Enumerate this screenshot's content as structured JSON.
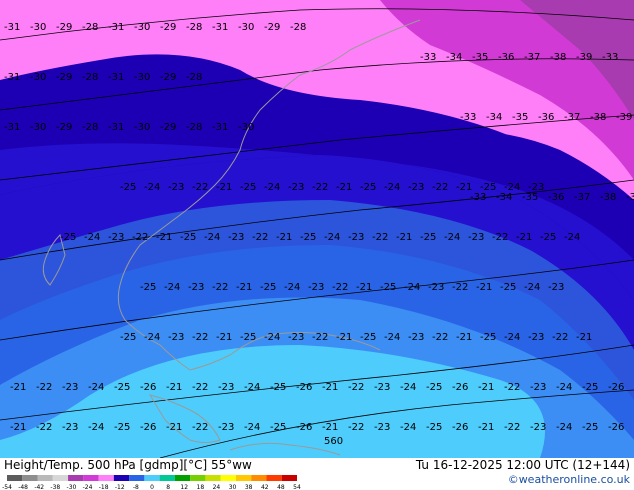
{
  "header": {
    "title": "Height/Temp. 500 hPa [gdmp][°C] 55°ww",
    "valid": "Tu 16-12-2025 12:00 UTC (12+144)",
    "credit": "©weatheronline.co.uk"
  },
  "map": {
    "contour_label": "560",
    "temperature_bands": [
      {
        "temp": -38,
        "color": "#a93bb0"
      },
      {
        "temp": -34,
        "color": "#d23ad6"
      },
      {
        "temp": -31,
        "color": "#ff7ff9"
      },
      {
        "temp": -29,
        "color": "#1e00b4"
      },
      {
        "temp": -27,
        "color": "#2510d0"
      },
      {
        "temp": -25,
        "color": "#2a64e6"
      },
      {
        "temp": -23,
        "color": "#3c8ef5"
      },
      {
        "temp": -22,
        "color": "#4aa8f8"
      },
      {
        "temp": -21,
        "color": "#4ecdfc"
      }
    ],
    "labels_top_left": [
      "-31",
      "-30",
      "-29",
      "-28"
    ],
    "labels_center": [
      "-25",
      "-24",
      "-23",
      "-22",
      "-21"
    ],
    "labels_right": [
      "-33",
      "-34",
      "-35",
      "-36",
      "-37",
      "-38",
      "-39"
    ],
    "labels_bottom": [
      "-21",
      "-22",
      "-23",
      "-24",
      "-25",
      "-26"
    ]
  },
  "legend": {
    "ticks": [
      "-54",
      "-48",
      "-42",
      "-38",
      "-30",
      "-24",
      "-18",
      "-12",
      "-8",
      "0",
      "8",
      "12",
      "18",
      "24",
      "30",
      "38",
      "42",
      "48",
      "54"
    ],
    "colors": [
      "#5c5c5c",
      "#8e8e8e",
      "#b9b9b9",
      "#d7d7d7",
      "#a93bb0",
      "#d23ad6",
      "#ff7ff9",
      "#1e00b4",
      "#2a64e6",
      "#4ecdfc",
      "#00c896",
      "#00a000",
      "#76d000",
      "#c8e000",
      "#ffff00",
      "#ffc800",
      "#ff8c00",
      "#ff3c00",
      "#c80000"
    ]
  }
}
